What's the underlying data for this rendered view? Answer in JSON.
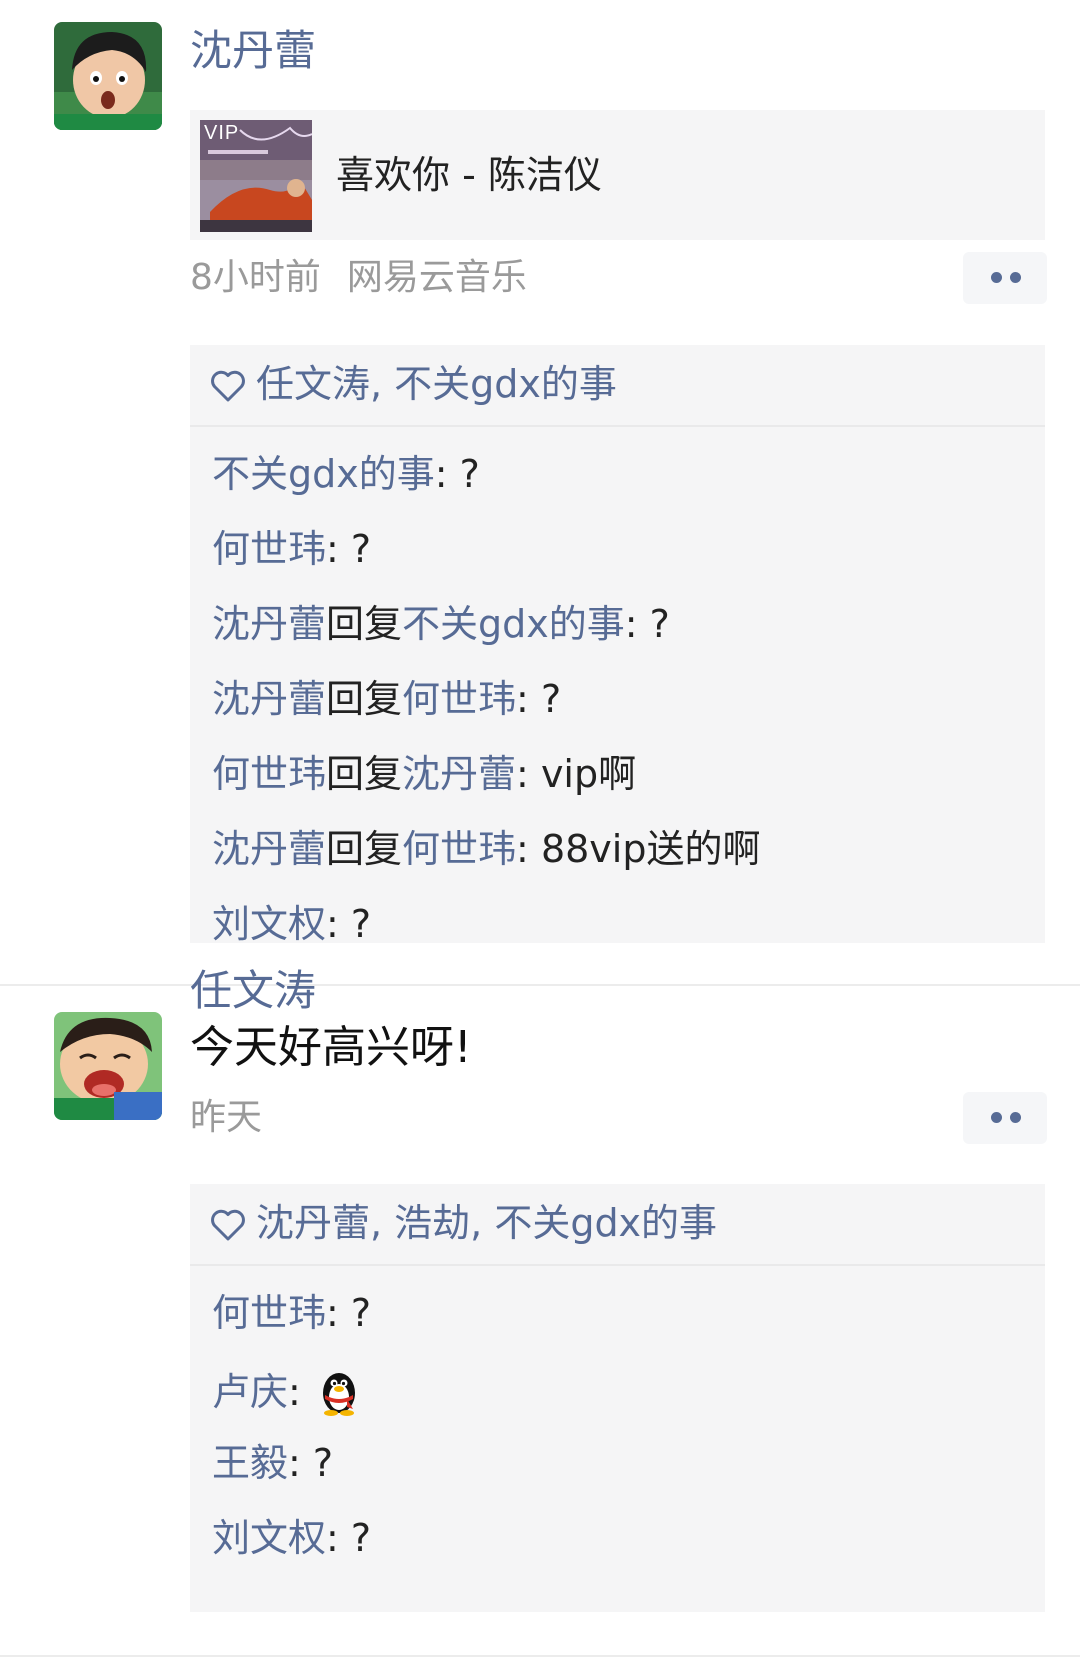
{
  "posts": [
    {
      "user": "沈丹蕾",
      "music": {
        "badge": "VIP",
        "title": "喜欢你 - 陈洁仪"
      },
      "time": "8小时前",
      "source": "网易云音乐",
      "likes": "任文涛, 不关gdx的事",
      "comments": [
        {
          "from": "不关gdx的事",
          "reply_word": "",
          "to": "",
          "sep": ": ",
          "text": "?"
        },
        {
          "from": "何世玮",
          "reply_word": "",
          "to": "",
          "sep": ": ",
          "text": "?"
        },
        {
          "from": "沈丹蕾",
          "reply_word": "回复",
          "to": "不关gdx的事",
          "sep": ": ",
          "text": "?"
        },
        {
          "from": "沈丹蕾",
          "reply_word": "回复",
          "to": "何世玮",
          "sep": ": ",
          "text": "?"
        },
        {
          "from": "何世玮",
          "reply_word": "回复",
          "to": "沈丹蕾",
          "sep": ": ",
          "text": "vip啊"
        },
        {
          "from": "沈丹蕾",
          "reply_word": "回复",
          "to": "何世玮",
          "sep": ": ",
          "text": "88vip送的啊"
        },
        {
          "from": "刘文权",
          "reply_word": "",
          "to": "",
          "sep": ": ",
          "text": "?"
        }
      ]
    },
    {
      "user": "任文涛",
      "text": "今天好高兴呀!",
      "time": "昨天",
      "likes": "沈丹蕾, 浩劫, 不关gdx的事",
      "comments": [
        {
          "from": "何世玮",
          "sep": ": ",
          "text": "?"
        },
        {
          "from": "卢庆",
          "sep": ": ",
          "text": "",
          "emoji": "qq-penguin-icon"
        },
        {
          "from": "王毅",
          "sep": ": ",
          "text": "?"
        },
        {
          "from": "刘文权",
          "sep": ": ",
          "text": "?"
        }
      ]
    }
  ],
  "colors": {
    "link": "#576b95",
    "meta": "#9a9a9a",
    "panel": "#f5f5f6"
  }
}
